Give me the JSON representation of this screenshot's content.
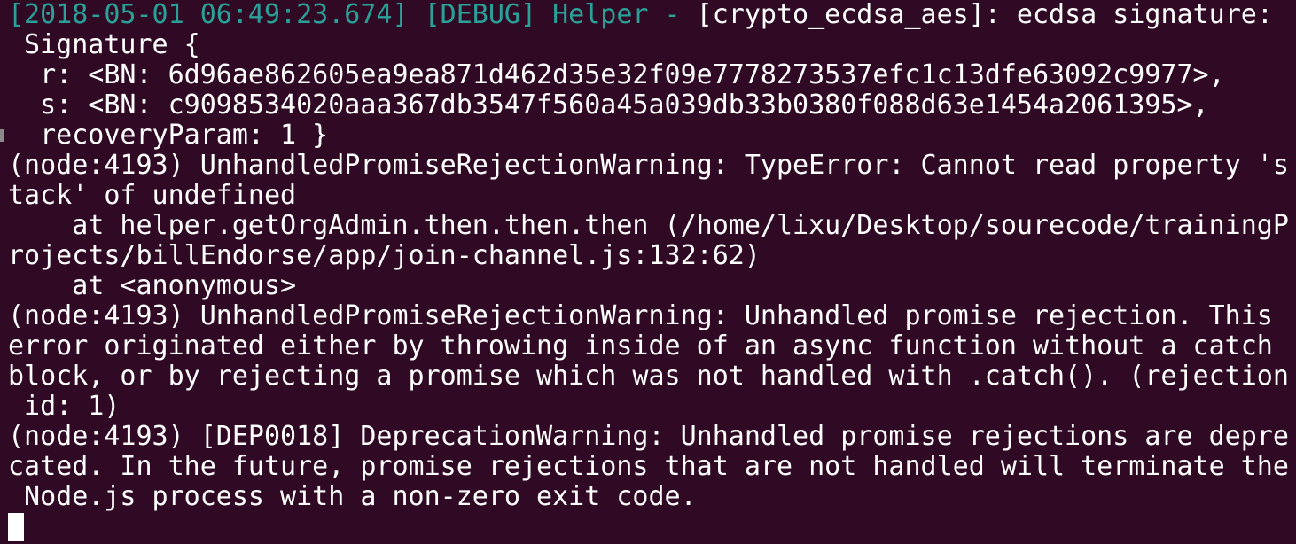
{
  "terminal": {
    "log_header": {
      "timestamp": "[2018-05-01 06:49:23.674]",
      "level": "[DEBUG]",
      "component": "Helper -",
      "message": "[crypto_ecdsa_aes]: ecdsa signature:"
    },
    "lines": [
      " Signature {",
      "  r: <BN: 6d96ae862605ea9ea871d462d35e32f09e7778273537efc1c13dfe63092c9977>,",
      "  s: <BN: c9098534020aaa367db3547f560a45a039db33b0380f088d63e1454a2061395>,",
      "  recoveryParam: 1 }",
      "(node:4193) UnhandledPromiseRejectionWarning: TypeError: Cannot read property 's",
      "tack' of undefined",
      "    at helper.getOrgAdmin.then.then.then (/home/lixu/Desktop/sourecode/trainingP",
      "rojects/billEndorse/app/join-channel.js:132:62)",
      "    at <anonymous>",
      "(node:4193) UnhandledPromiseRejectionWarning: Unhandled promise rejection. This",
      "error originated either by throwing inside of an async function without a catch",
      "block, or by rejecting a promise which was not handled with .catch(). (rejection",
      " id: 1)",
      "(node:4193) [DEP0018] DeprecationWarning: Unhandled promise rejections are depre",
      "cated. In the future, promise rejections that are not handled will terminate the",
      " Node.js process with a non-zero exit code."
    ]
  },
  "colors": {
    "background": "#300a24",
    "text": "#ffffff",
    "log_prefix": "#2aa198"
  }
}
